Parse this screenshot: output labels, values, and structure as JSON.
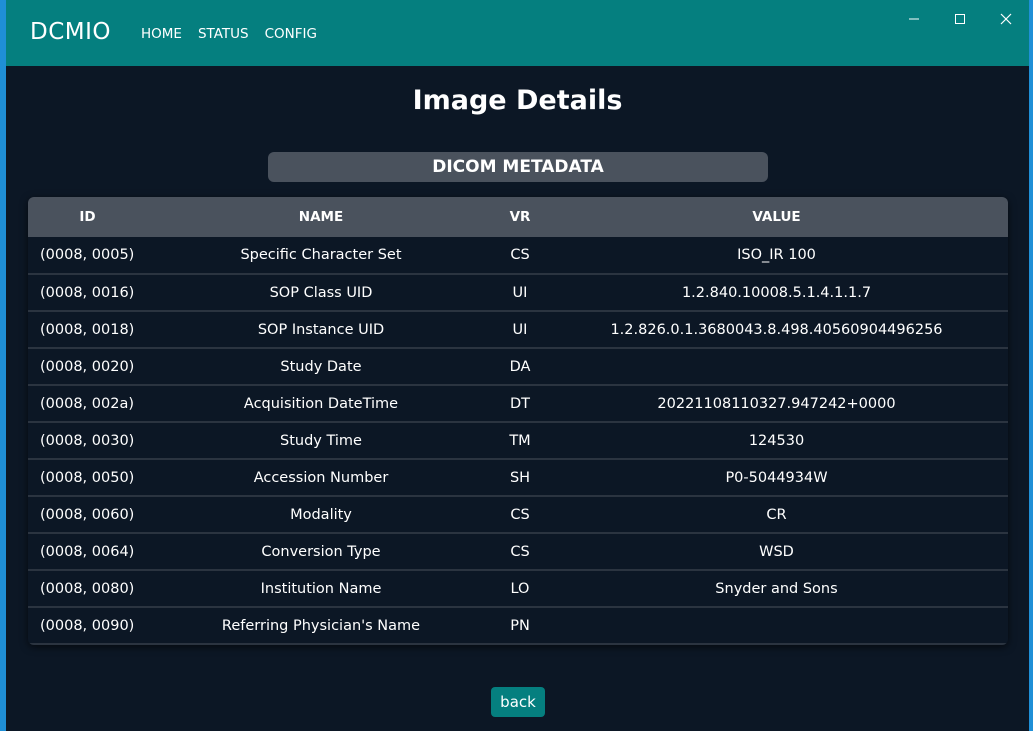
{
  "app": {
    "brand": "DCMIO",
    "nav": [
      {
        "label": "HOME"
      },
      {
        "label": "STATUS"
      },
      {
        "label": "CONFIG"
      }
    ]
  },
  "page": {
    "title": "Image Details",
    "section": "DICOM METADATA",
    "back_label": "back"
  },
  "table": {
    "headers": {
      "id": "ID",
      "name": "NAME",
      "vr": "VR",
      "value": "VALUE"
    },
    "rows": [
      {
        "id": "(0008, 0005)",
        "name": "Specific Character Set",
        "vr": "CS",
        "value": "ISO_IR 100"
      },
      {
        "id": "(0008, 0016)",
        "name": "SOP Class UID",
        "vr": "UI",
        "value": "1.2.840.10008.5.1.4.1.1.7"
      },
      {
        "id": "(0008, 0018)",
        "name": "SOP Instance UID",
        "vr": "UI",
        "value": "1.2.826.0.1.3680043.8.498.40560904496256"
      },
      {
        "id": "(0008, 0020)",
        "name": "Study Date",
        "vr": "DA",
        "value": ""
      },
      {
        "id": "(0008, 002a)",
        "name": "Acquisition DateTime",
        "vr": "DT",
        "value": "20221108110327.947242+0000"
      },
      {
        "id": "(0008, 0030)",
        "name": "Study Time",
        "vr": "TM",
        "value": "124530"
      },
      {
        "id": "(0008, 0050)",
        "name": "Accession Number",
        "vr": "SH",
        "value": "P0-5044934W"
      },
      {
        "id": "(0008, 0060)",
        "name": "Modality",
        "vr": "CS",
        "value": "CR"
      },
      {
        "id": "(0008, 0064)",
        "name": "Conversion Type",
        "vr": "CS",
        "value": "WSD"
      },
      {
        "id": "(0008, 0080)",
        "name": "Institution Name",
        "vr": "LO",
        "value": "Snyder and Sons"
      },
      {
        "id": "(0008, 0090)",
        "name": "Referring Physician's Name",
        "vr": "PN",
        "value": ""
      }
    ]
  },
  "colors": {
    "accent": "#057f7f",
    "background": "#0c1725",
    "header_bg": "#4a525d"
  },
  "icons": {
    "minimize": "minimize-icon",
    "maximize": "maximize-icon",
    "close": "close-icon"
  }
}
